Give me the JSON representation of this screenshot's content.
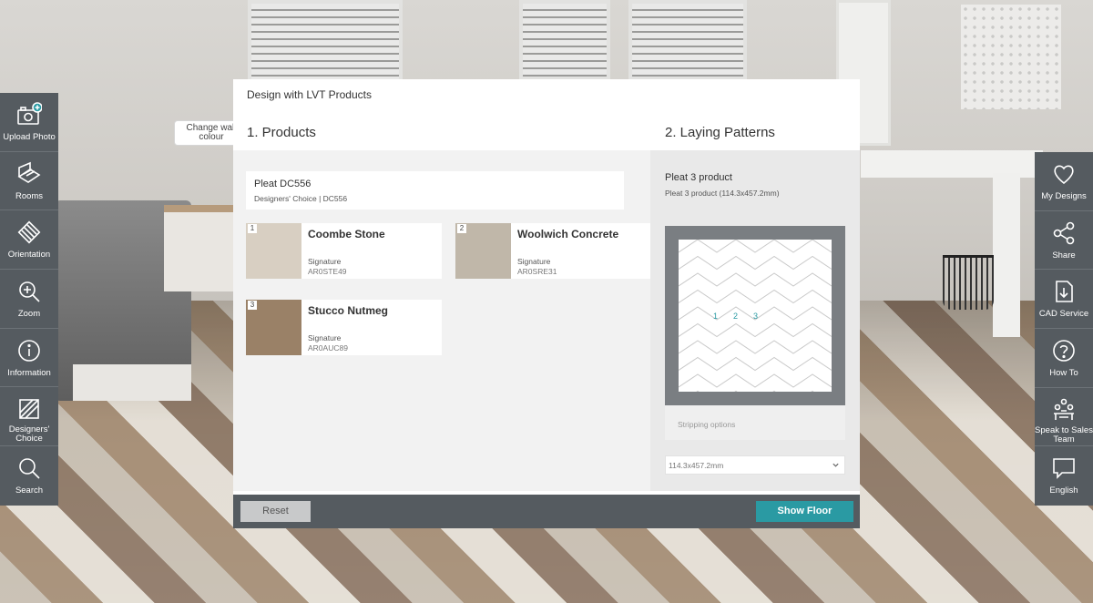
{
  "left_toolbar": [
    {
      "label": "Upload Photo",
      "icon": "upload-photo-icon"
    },
    {
      "label": "Rooms",
      "icon": "rooms-icon"
    },
    {
      "label": "Orientation",
      "icon": "orientation-icon"
    },
    {
      "label": "Zoom",
      "icon": "zoom-icon"
    },
    {
      "label": "Information",
      "icon": "information-icon"
    },
    {
      "label": "Designers' Choice",
      "icon": "designers-choice-icon"
    },
    {
      "label": "Search",
      "icon": "search-icon"
    }
  ],
  "right_toolbar": [
    {
      "label": "My Designs",
      "icon": "heart-icon"
    },
    {
      "label": "Share",
      "icon": "share-icon"
    },
    {
      "label": "CAD Service",
      "icon": "download-icon"
    },
    {
      "label": "How To",
      "icon": "help-icon"
    },
    {
      "label": "Speak to Sales Team",
      "icon": "sales-team-icon"
    },
    {
      "label": "English",
      "icon": "speech-bubble-icon"
    }
  ],
  "tooltip": {
    "text": "Change wall colour"
  },
  "modal": {
    "title": "Design with LVT Products",
    "products_heading": "1. Products",
    "patterns_heading": "2. Laying Patterns",
    "selected": {
      "name": "Pleat DC556",
      "subtitle": "Designers' Choice | DC556"
    },
    "products": [
      {
        "num": "1",
        "name": "Coombe Stone",
        "collection": "Signature",
        "code": "AR0STE49",
        "color": "#d8cfc2"
      },
      {
        "num": "2",
        "name": "Woolwich Concrete",
        "collection": "Signature",
        "code": "AR0SRE31",
        "color": "#c0b7a9"
      },
      {
        "num": "3",
        "name": "Stucco Nutmeg",
        "collection": "Signature",
        "code": "AR0AUC89",
        "color": "#9a8167"
      }
    ],
    "pattern": {
      "name": "Pleat 3 product",
      "subtitle": "Pleat 3 product (114.3x457.2mm)",
      "numbers": [
        "1",
        "2",
        "3"
      ],
      "stripping_label": "Stripping options",
      "size_value": "114.3x457.2mm"
    },
    "buttons": {
      "reset": "Reset",
      "show_floor": "Show Floor"
    },
    "accent": "#2a9aa3"
  }
}
